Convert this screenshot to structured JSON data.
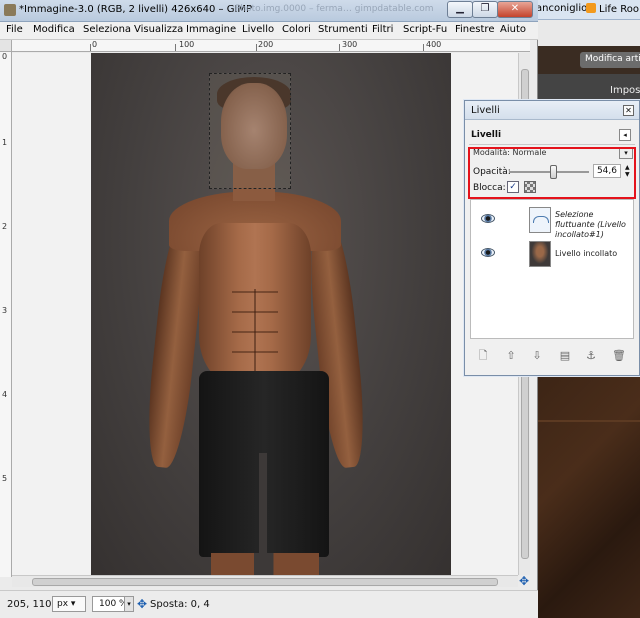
{
  "window": {
    "title": "*Immagine-3.0 (RGB, 2 livelli) 426x640 – GIMP",
    "ghost_title": "Photo.img.0000 – ferma…  gimpdatable.com",
    "min": "▁",
    "max": "❐",
    "close": "✕"
  },
  "background_browser": {
    "tab1": "anconiglio",
    "tab2": "Life Roo",
    "button": "Modifica artic",
    "heading": "Impos"
  },
  "menubar": [
    "File",
    "Modifica",
    "Seleziona",
    "Visualizza",
    "Immagine",
    "Livello",
    "Colori",
    "Strumenti",
    "Filtri",
    "Script-Fu",
    "Finestre",
    "Aiuto"
  ],
  "ruler": {
    "h_labels": [
      "0",
      "100",
      "200",
      "300",
      "400"
    ],
    "v_labels": [
      "0",
      "1",
      "2",
      "3",
      "4",
      "5"
    ]
  },
  "statusbar": {
    "coords": "205, 110",
    "unit": "px ▾",
    "zoom": "100 %",
    "zoom_arrow": "▾",
    "message": "Sposta: 0, 4"
  },
  "layers_dialog": {
    "title": "Livelli",
    "close": "✕",
    "tab": "Livelli",
    "tab_menu": "◂",
    "mode_label": "Modalità: Normale",
    "mode_arrow": "▾",
    "opacity_label": "Opacità:",
    "opacity": 54.6,
    "opacity_value": "54,6",
    "lock_label": "Blocca:",
    "lock_check": "✓",
    "layers": [
      {
        "name": "Selezione fluttuante (Livello incollato#1)",
        "italic": true
      },
      {
        "name": "Livello incollato",
        "italic": false
      }
    ],
    "footer_icons": [
      "new-layer-icon",
      "raise-layer-icon",
      "lower-layer-icon",
      "duplicate-layer-icon",
      "anchor-layer-icon",
      "delete-layer-icon"
    ]
  },
  "colors": {
    "highlight_box": "#e4121b",
    "title_bar": "#c4d2e4"
  }
}
